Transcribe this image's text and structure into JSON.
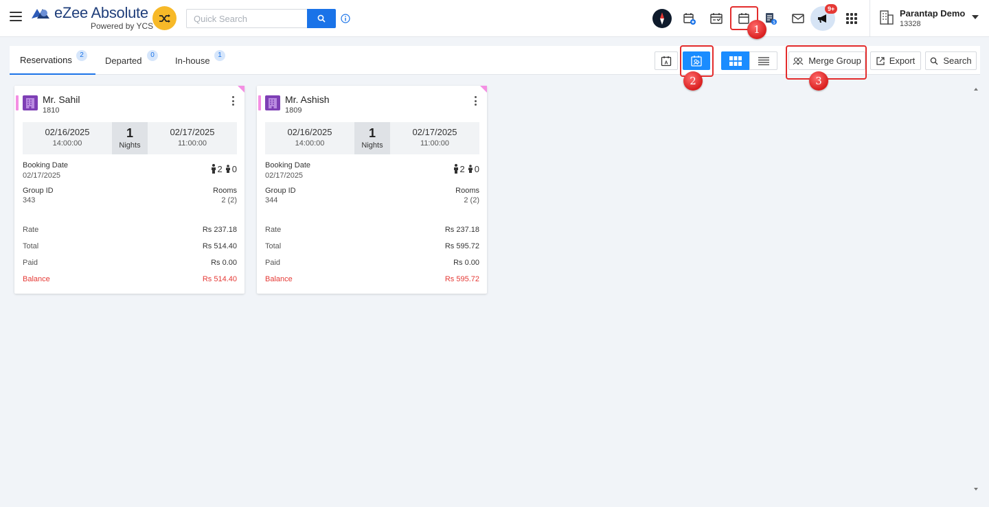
{
  "header": {
    "logo_title": "eZee Absolute",
    "logo_subtitle": "Powered by YCS",
    "search_placeholder": "Quick Search",
    "notification_badge": "9+",
    "property_name": "Parantap Demo",
    "property_id": "13328"
  },
  "annotations": [
    "1",
    "2",
    "3"
  ],
  "tabs": [
    {
      "label": "Reservations",
      "count": "2",
      "active": true
    },
    {
      "label": "Departed",
      "count": "0",
      "active": false
    },
    {
      "label": "In-house",
      "count": "1",
      "active": false
    }
  ],
  "toolbar": {
    "merge_group_label": "Merge Group",
    "export_label": "Export",
    "search_label": "Search"
  },
  "card_labels": {
    "nights": "Nights",
    "booking_date": "Booking Date",
    "group_id": "Group ID",
    "rooms": "Rooms",
    "rate": "Rate",
    "total": "Total",
    "paid": "Paid",
    "balance": "Balance"
  },
  "reservations": [
    {
      "guest": "Mr. Sahil",
      "res_no": "1810",
      "arrival_date": "02/16/2025",
      "arrival_time": "14:00:00",
      "nights": "1",
      "departure_date": "02/17/2025",
      "departure_time": "11:00:00",
      "booking_date": "02/17/2025",
      "adults": "2",
      "children": "0",
      "group_id": "343",
      "rooms": "2 (2)",
      "rate": "Rs 237.18",
      "total": "Rs 514.40",
      "paid": "Rs 0.00",
      "balance": "Rs 514.40"
    },
    {
      "guest": "Mr. Ashish",
      "res_no": "1809",
      "arrival_date": "02/16/2025",
      "arrival_time": "14:00:00",
      "nights": "1",
      "departure_date": "02/17/2025",
      "departure_time": "11:00:00",
      "booking_date": "02/17/2025",
      "adults": "2",
      "children": "0",
      "group_id": "344",
      "rooms": "2 (2)",
      "rate": "Rs 237.18",
      "total": "Rs 595.72",
      "paid": "Rs 0.00",
      "balance": "Rs 595.72"
    }
  ],
  "colors": {
    "primary": "#1a73e8",
    "accent_yellow": "#f7b928",
    "balance_red": "#e53935",
    "annotation_red": "#e32b2b",
    "group_flag_pink": "#f48fe3"
  }
}
